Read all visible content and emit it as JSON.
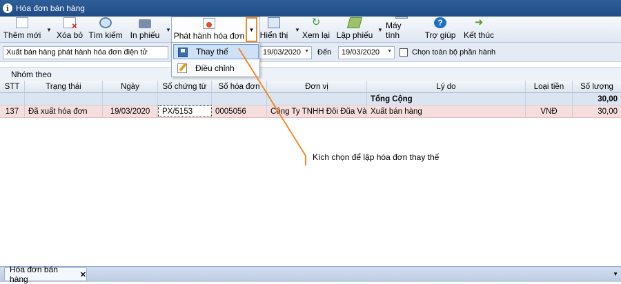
{
  "window": {
    "title": "Hóa đơn bán hàng"
  },
  "toolbar": {
    "add": "Thêm mới",
    "delete": "Xóa bỏ",
    "search": "Tìm kiếm",
    "print": "In phiếu",
    "publish": "Phát hành hóa đơn",
    "view": "Hiển thị",
    "review": "Xem lại",
    "create_form": "Lập phiếu",
    "calculator": "Máy tính",
    "help": "Trợ giúp",
    "exit": "Kết thúc"
  },
  "publish_menu": {
    "items": [
      {
        "label": "Thay thế",
        "icon": "floppy-icon"
      },
      {
        "label": "Điều chỉnh",
        "icon": "edit-icon"
      }
    ]
  },
  "filter": {
    "type_value": "Xuất bán hàng phát hành hóa đơn điện tử",
    "from_value": "19/03/2020",
    "to_label": "Đến",
    "to_value": "19/03/2020",
    "select_all_label": "Chọn toàn bộ phần hành"
  },
  "groupby": {
    "label": "Nhóm theo"
  },
  "grid": {
    "columns": [
      "STT",
      "Trạng thái",
      "Ngày",
      "Số chứng từ",
      "Số hóa đơn",
      "Đơn vị",
      "Lý do",
      "Loại tiền",
      "Số lượng"
    ],
    "total": {
      "label": "Tổng Cộng",
      "quantity": "30,00"
    },
    "rows": [
      {
        "stt": "137",
        "status": "Đã xuất hóa đơn",
        "date": "19/03/2020",
        "voucher": "PX/5153",
        "invoice": "0005056",
        "unit": "Công Ty TNHH Đôi Đũa Vàng",
        "reason": "Xuất bán hàng",
        "currency": "VNĐ",
        "quantity": "30,00"
      }
    ]
  },
  "callout": {
    "text": "Kích chọn để lập hóa đơn thay thế"
  },
  "tabs": [
    {
      "label": "Hóa đơn bán hàng"
    }
  ],
  "colors": {
    "title_bar": "#1f4c86",
    "highlight_row": "#f7dede",
    "callout": "#f0882a"
  }
}
